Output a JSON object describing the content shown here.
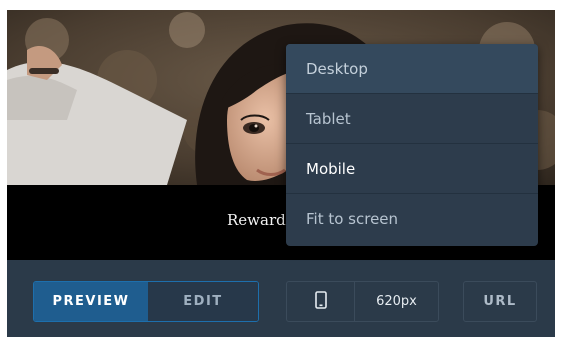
{
  "preview": {
    "caption": "Rewards"
  },
  "toolbar": {
    "preview_label": "PREVIEW",
    "edit_label": "EDIT",
    "device_icon": "mobile-phone-icon",
    "width_value": "620px",
    "url_label": "URL"
  },
  "device_menu": {
    "items": [
      {
        "label": "Desktop"
      },
      {
        "label": "Tablet"
      },
      {
        "label": "Mobile"
      },
      {
        "label": "Fit to screen"
      }
    ]
  },
  "colors": {
    "toolbar_bg": "#2b3a49",
    "active_mode": "#1f5d8f",
    "menu_bg": "#2d3c4c"
  }
}
